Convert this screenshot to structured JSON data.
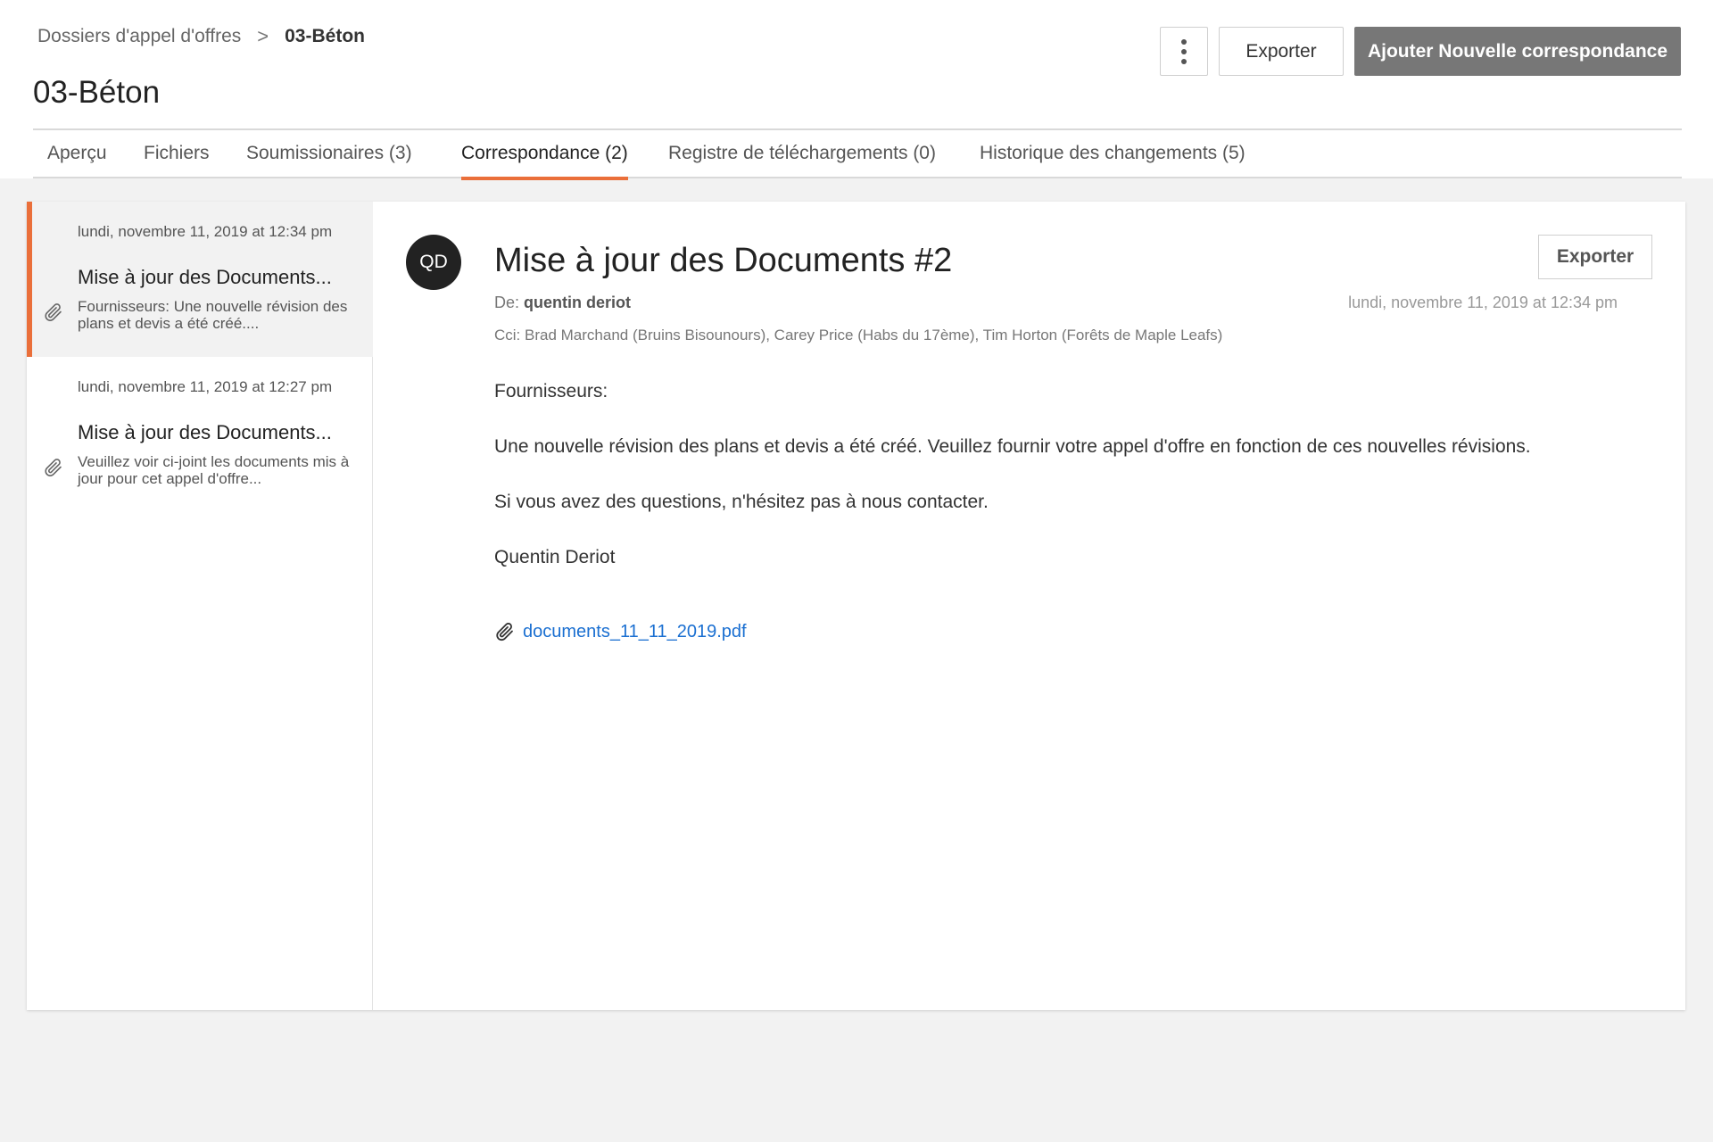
{
  "breadcrumb": {
    "parent": "Dossiers d'appel d'offres",
    "separator": ">",
    "current": "03-Béton"
  },
  "page_title": "03-Béton",
  "header_actions": {
    "export_label": "Exporter",
    "add_label": "Ajouter Nouvelle correspondance"
  },
  "tabs": [
    {
      "label": "Aperçu"
    },
    {
      "label": "Fichiers"
    },
    {
      "label": "Soumissionaires (3)"
    },
    {
      "label": "Correspondance (2)",
      "active": true
    },
    {
      "label": "Registre de téléchargements (0)"
    },
    {
      "label": "Historique des changements (5)"
    }
  ],
  "messages": [
    {
      "date": "lundi, novembre 11, 2019 at 12:34 pm",
      "subject": "Mise à jour des Documents...",
      "preview": "Fournisseurs:  Une nouvelle révision des plans et devis a été créé....",
      "selected": true,
      "icon": "paperclip-icon"
    },
    {
      "date": "lundi, novembre 11, 2019 at 12:27 pm",
      "subject": "Mise à jour des Documents...",
      "preview": "Veuillez voir ci-joint les documents mis à jour pour cet appel d'offre...",
      "selected": false,
      "icon": "paperclip-icon"
    }
  ],
  "detail": {
    "avatar_initials": "QD",
    "subject": "Mise à jour des Documents #2",
    "export_label": "Exporter",
    "from_label": "De:",
    "from_name": "quentin deriot",
    "date": "lundi, novembre 11, 2019 at 12:34 pm",
    "cc": "Cci: Brad Marchand (Bruins Bisounours), Carey Price (Habs du 17ème), Tim Horton (Forêts de Maple Leafs)",
    "body": [
      "Fournisseurs:",
      "Une nouvelle révision des plans et devis a été créé. Veuillez fournir votre appel d'offre en fonction de ces nouvelles révisions.",
      "Si vous avez des questions, n'hésitez pas à nous contacter.",
      "Quentin Deriot"
    ],
    "attachment": "documents_11_11_2019.pdf"
  },
  "colors": {
    "accent": "#ea6f3a",
    "link": "#1a6fd1",
    "primary_button": "#777777"
  }
}
